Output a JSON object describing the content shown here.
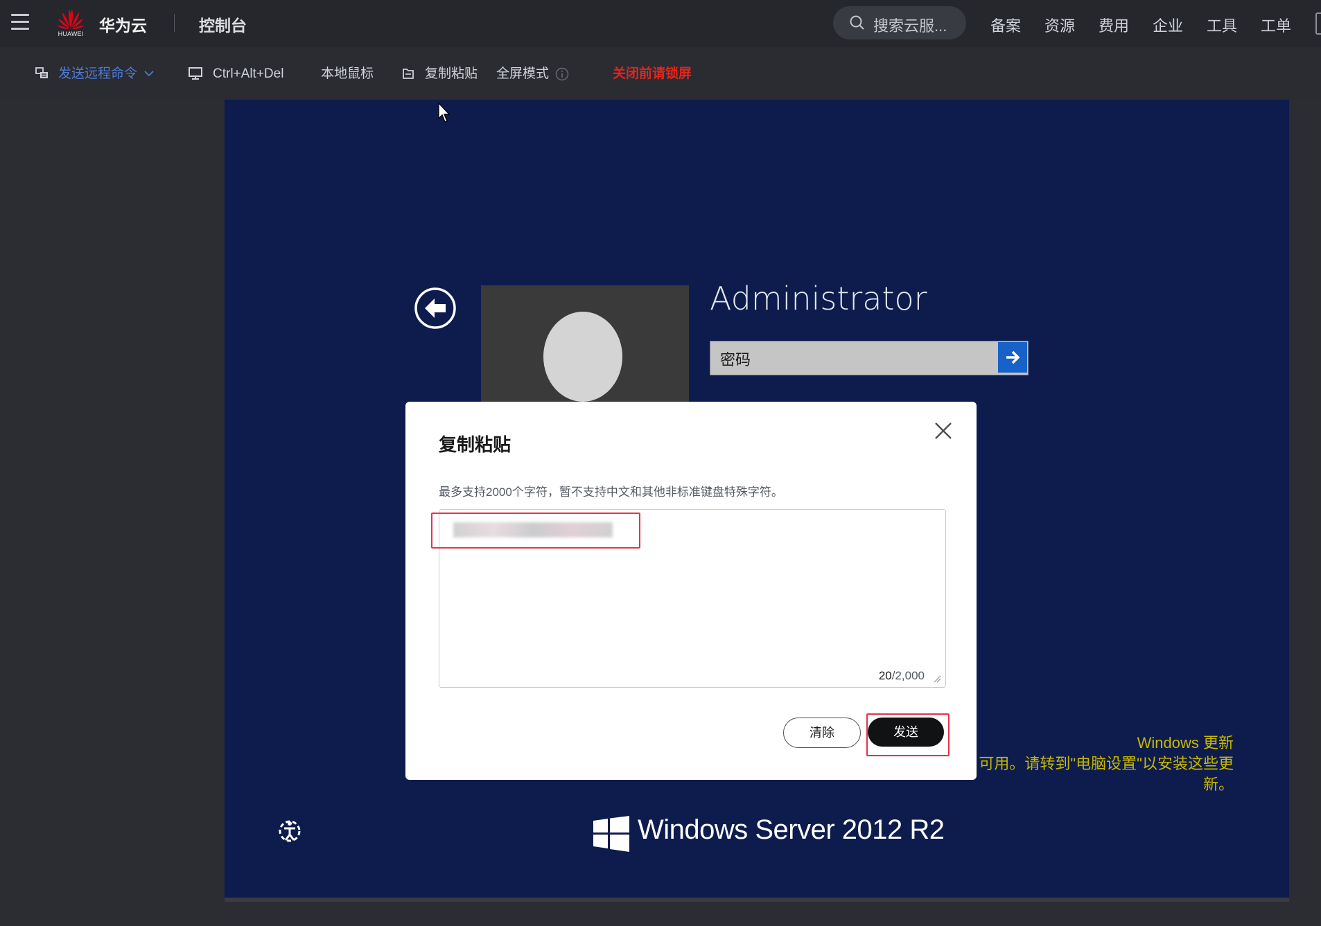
{
  "topbar": {
    "brand": "华为云",
    "logo_text": "HUAWEI",
    "console": "控制台",
    "search_placeholder": "搜索云服...",
    "nav": [
      "备案",
      "资源",
      "费用",
      "企业",
      "工具",
      "工单"
    ]
  },
  "toolbar": {
    "send_command": "发送远程命令",
    "ctrl_alt_del": "Ctrl+Alt+Del",
    "local_mouse": "本地鼠标",
    "copy_paste": "复制粘贴",
    "fullscreen": "全屏模式",
    "warning": "关闭前请锁屏"
  },
  "login": {
    "username": "Administrator",
    "password_placeholder": "密码"
  },
  "windows": {
    "update_title": "Windows 更新",
    "update_line1": "可用。请转到\"电脑设置\"以安装这些更",
    "update_line2": "新。",
    "brand": "Windows Server 2012 R2"
  },
  "dialog": {
    "title": "复制粘贴",
    "hint": "最多支持2000个字符，暂不支持中文和其他非标准键盘特殊字符。",
    "count_current": "20",
    "count_max": "/2,000",
    "clear_label": "清除",
    "send_label": "发送"
  },
  "colors": {
    "topbar_bg": "#25272d",
    "toolbar_bg": "#2a2c32",
    "stage_bg": "#0d1c4d",
    "accent_blue": "#4f7bd8",
    "warning_red": "#e1261c",
    "update_yellow": "#c8b800",
    "highlight_red": "#e4334a",
    "win_submit_blue": "#1662c8"
  }
}
